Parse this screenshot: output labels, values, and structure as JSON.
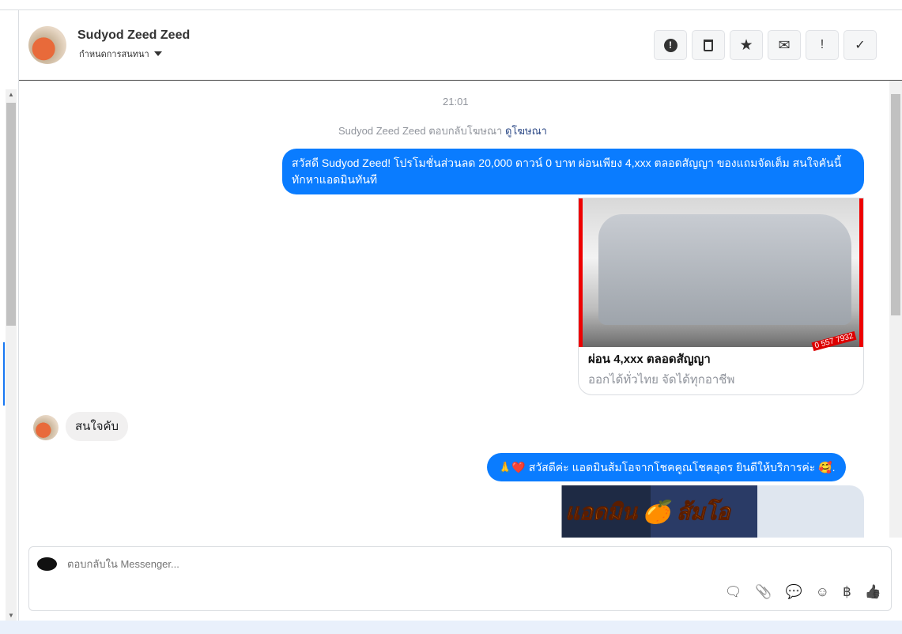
{
  "header": {
    "name": "Sudyod Zeed Zeed",
    "subtitle": "กำหนดการสนทนา"
  },
  "toolbar": [
    {
      "name": "spam",
      "glyph": "❗"
    },
    {
      "name": "trash",
      "glyph": "🗑"
    },
    {
      "name": "star",
      "glyph": "★"
    },
    {
      "name": "mark-unread",
      "glyph": "✉"
    },
    {
      "name": "important",
      "glyph": "!"
    },
    {
      "name": "done",
      "glyph": "✓"
    }
  ],
  "conversation": {
    "timestamp": "21:01",
    "reply_note": "Sudyod Zeed Zeed ตอบกลับโฆษณา",
    "reply_link": "ดูโฆษณา",
    "msg1": "สวัสดี Sudyod Zeed! โปรโมชั่นส่วนลด 20,000 ดาวน์ 0 บาท ผ่อนเพียง 4,xxx ตลอดสัญญา ของแถมจัดเต็ม สนใจคันนี้ทักหาแอดมินทันที",
    "card_title": "ผ่อน 4,xxx ตลอดสัญญา",
    "card_subtitle": "ออกได้ทั่วไทย จัดได้ทุกอาชีพ",
    "card_phone": "0 557 7932",
    "msg2": "สนใจคับ",
    "msg3": "🙏❤️ สวัสดีค่ะ แอดมินส้มโอจากโชคคูณโชคอุดร ยินดีให้บริการค่ะ 🥰.",
    "banner_text": "แอดมิน 🍊 ส้มโอ"
  },
  "composer": {
    "placeholder": "ตอบกลับใน Messenger...",
    "icons": [
      "saved-reply",
      "attach",
      "quick-reply",
      "emoji",
      "baht",
      "like"
    ],
    "glyphs": {
      "saved": "🗨",
      "attach": "📎",
      "quick": "💬",
      "emoji": "☺",
      "baht": "฿",
      "like": "👍"
    }
  }
}
